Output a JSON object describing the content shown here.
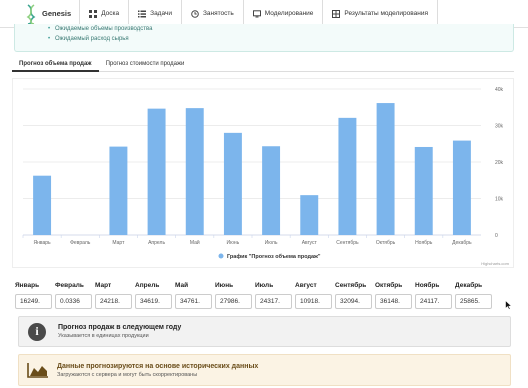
{
  "app": {
    "name": "Genesis"
  },
  "nav": {
    "items": [
      {
        "label": "Доска",
        "icon": "dashboard-icon"
      },
      {
        "label": "Задачи",
        "icon": "list-icon"
      },
      {
        "label": "Занятость",
        "icon": "clock-icon"
      },
      {
        "label": "Моделирование",
        "icon": "monitor-icon"
      },
      {
        "label": "Результаты моделирования",
        "icon": "grid-icon"
      }
    ]
  },
  "info": {
    "items": [
      "Ожидаемые объемы производства",
      "Ожидаемый расход сырья"
    ]
  },
  "tabs": [
    {
      "label": "Прогноз объема продаж",
      "active": true
    },
    {
      "label": "Прогноз стоимости продажи",
      "active": false
    }
  ],
  "chart_data": {
    "type": "bar",
    "categories": [
      "Январь",
      "Февраль",
      "Март",
      "Апрель",
      "Май",
      "Июнь",
      "Июль",
      "Август",
      "Сентябрь",
      "Октябрь",
      "Ноябрь",
      "Декабрь"
    ],
    "series": [
      {
        "name": "График \"Прогноз объема продаж\"",
        "values": [
          16249,
          0.0336,
          24218,
          34619,
          34761,
          27986,
          24317,
          10918,
          32094,
          36148,
          24117,
          25865
        ]
      }
    ],
    "ylim": [
      0,
      40000
    ],
    "yticks": [
      "0",
      "10k",
      "20k",
      "30k",
      "40k"
    ],
    "color": "#7cb5ec",
    "credits": "Highcharts.com",
    "legend": "bottom-center",
    "grid": true
  },
  "inputs": [
    {
      "label": "Январь",
      "value": "16249."
    },
    {
      "label": "Февраль",
      "value": "0.0336"
    },
    {
      "label": "Март",
      "value": "24218."
    },
    {
      "label": "Апрель",
      "value": "34619."
    },
    {
      "label": "Май",
      "value": "34761."
    },
    {
      "label": "Июнь",
      "value": "27986."
    },
    {
      "label": "Июль",
      "value": "24317."
    },
    {
      "label": "Август",
      "value": "10918."
    },
    {
      "label": "Сентябрь",
      "value": "32094."
    },
    {
      "label": "Октябрь",
      "value": "36148."
    },
    {
      "label": "Ноябрь",
      "value": "24117."
    },
    {
      "label": "Декабрь",
      "value": "25865."
    }
  ],
  "card_info": {
    "title": "Прогноз продаж в следующем году",
    "subtitle": "Указывается в единицах продукции",
    "icon": "info-icon"
  },
  "card_warning": {
    "title": "Данные прогнозируются на основе исторических данных",
    "subtitle": "Загружаются с сервера и могут быть скорректированы",
    "icon": "area-chart-icon",
    "color": "#6a4d1a"
  }
}
